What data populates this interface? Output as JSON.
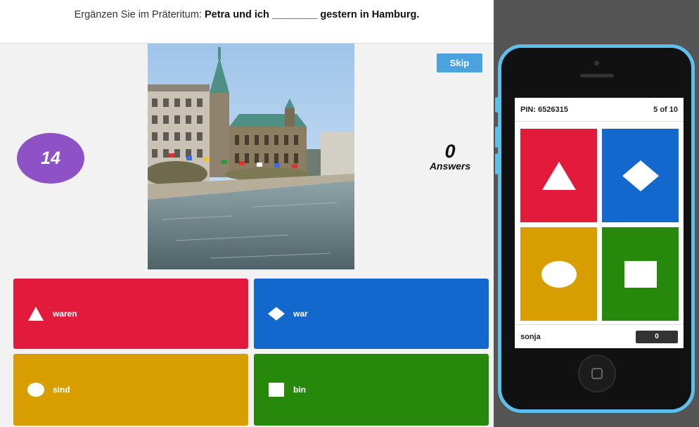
{
  "question": {
    "prefix": "Ergänzen Sie im Präteritum: ",
    "bold": "Petra und ich ________ gestern in Hamburg."
  },
  "timer": {
    "value": "14"
  },
  "skip": {
    "label": "Skip"
  },
  "answers_count": {
    "value": "0",
    "label": "Answers"
  },
  "answers": [
    {
      "label": "waren",
      "shape": "triangle-icon",
      "color": "#e21b3c"
    },
    {
      "label": "war",
      "shape": "diamond-icon",
      "color": "#1368ce"
    },
    {
      "label": "sind",
      "shape": "circle-icon",
      "color": "#d89e00"
    },
    {
      "label": "bin",
      "shape": "square-icon",
      "color": "#26890c"
    }
  ],
  "phone": {
    "pin": "PIN: 6526315",
    "progress": "5 of 10",
    "player": "sonja",
    "score": "0",
    "frame_color": "#5bc0eb"
  }
}
